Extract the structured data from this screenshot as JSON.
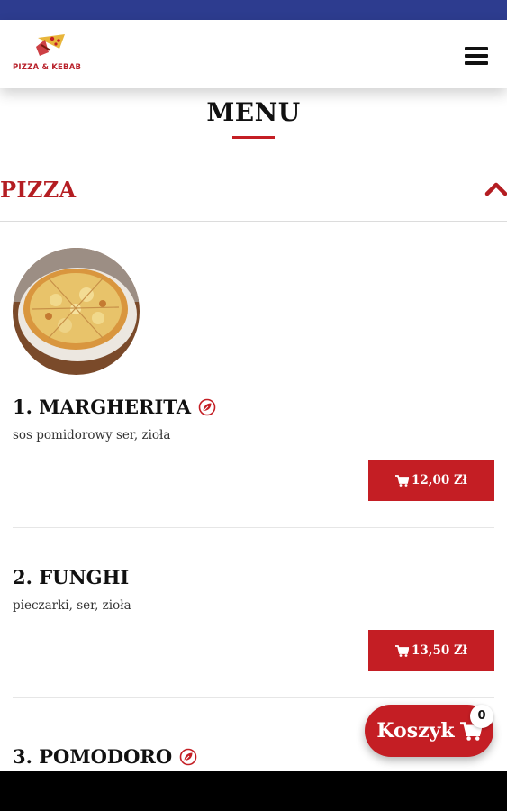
{
  "header": {
    "logo_text": "PIZZA & KEBAB"
  },
  "page": {
    "title": "MENU"
  },
  "category": {
    "title": "PIZZA",
    "expanded": true
  },
  "products": [
    {
      "name": "1. MARGHERITA",
      "description": "sos pomidorowy ser, zioła",
      "price": "12,00 Zł",
      "vegetarian": true
    },
    {
      "name": "2. FUNGHI",
      "description": "pieczarki, ser, zioła",
      "price": "13,50 Zł",
      "vegetarian": false
    },
    {
      "name": "3. POMODORO",
      "vegetarian": true
    }
  ],
  "cart": {
    "label": "Koszyk",
    "count": "0"
  },
  "colors": {
    "accent": "#c41e24",
    "status_bar": "#2d3c8f",
    "category_title": "#b41d22"
  }
}
